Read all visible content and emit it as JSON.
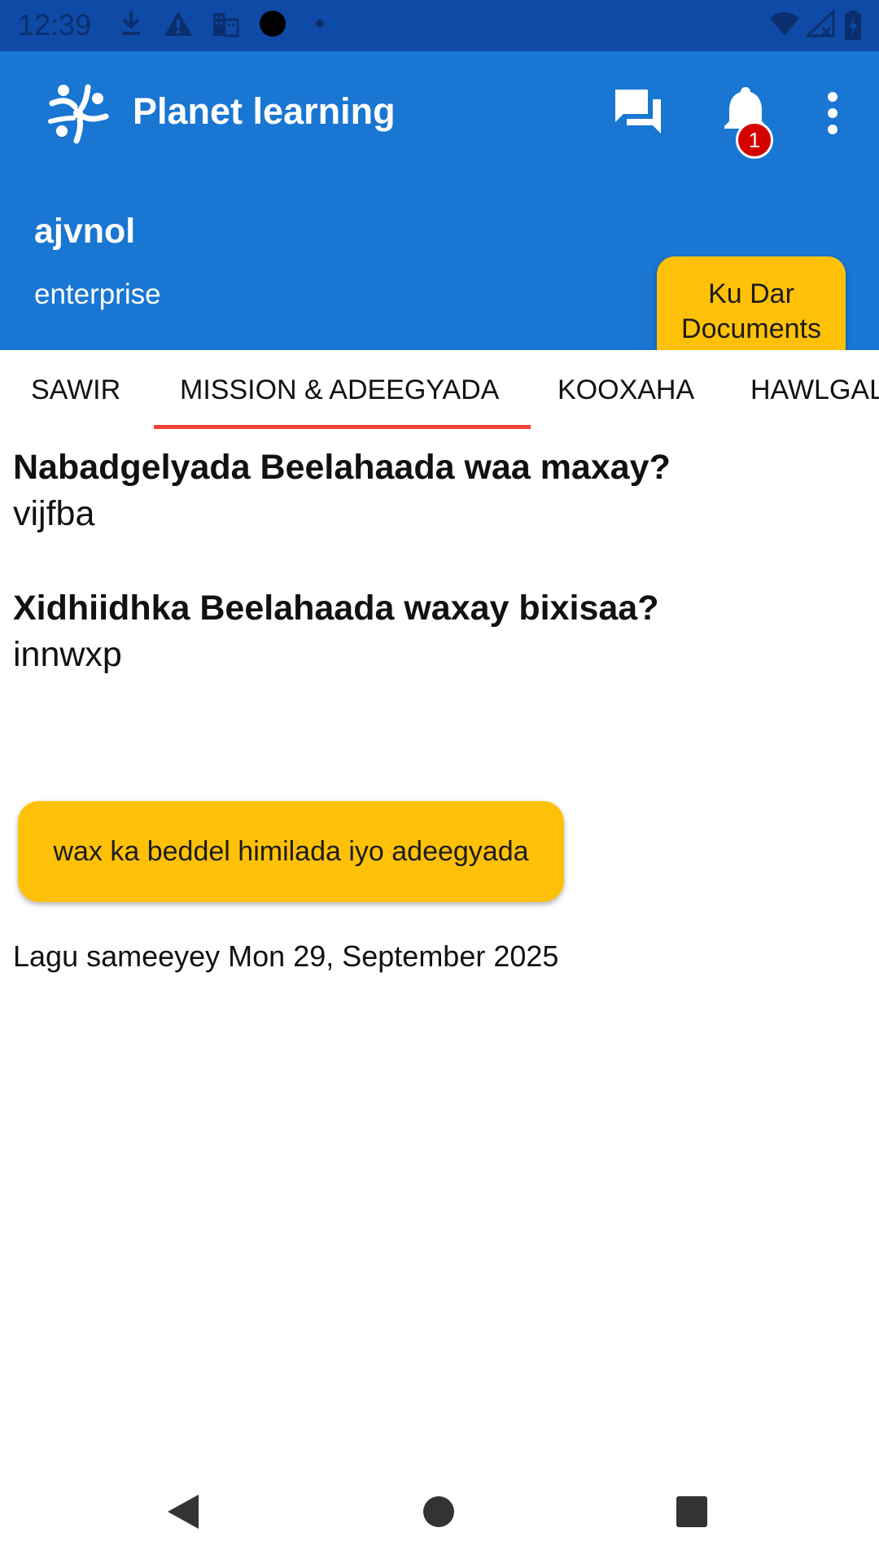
{
  "status_bar": {
    "time": "12:39",
    "left_icons": [
      "download-icon",
      "warning-icon",
      "building-icon",
      "circle-icon",
      "dot-icon"
    ],
    "right_icons": [
      "wifi-icon",
      "signal-icon",
      "battery-charging-icon"
    ]
  },
  "app_bar": {
    "title": "Planet learning",
    "notification_count": "1",
    "actions": [
      "chat-icon",
      "bell-icon",
      "more-vert-icon"
    ]
  },
  "team_header": {
    "name": "ajvnol",
    "type": "enterprise",
    "documents_button": "Ku Dar Documents"
  },
  "tabs": [
    {
      "label": "SAWIR",
      "selected": false
    },
    {
      "label": "MISSION & ADEEGYADA",
      "selected": true
    },
    {
      "label": "KOOXAHA",
      "selected": false
    },
    {
      "label": "HAWLGAL",
      "selected": false
    }
  ],
  "content": {
    "mission_question": "Nabadgelyada Beelahaada waa maxay?",
    "mission_answer": "vijfba",
    "services_question": "Xidhiidhka Beelahaada waxay bixisaa?",
    "services_answer": "innwxp",
    "edit_button": "wax ka beddel himilada iyo adeegyada",
    "created_text": "Lagu sameeyey Mon 29, September 2025"
  },
  "colors": {
    "primary": "#1976d2",
    "status_bar": "#0f4aa6",
    "accent_button": "#ffc107",
    "tab_indicator": "#f44336",
    "badge": "#d50000"
  },
  "nav_bar": [
    "back-icon",
    "home-icon",
    "recents-icon"
  ]
}
